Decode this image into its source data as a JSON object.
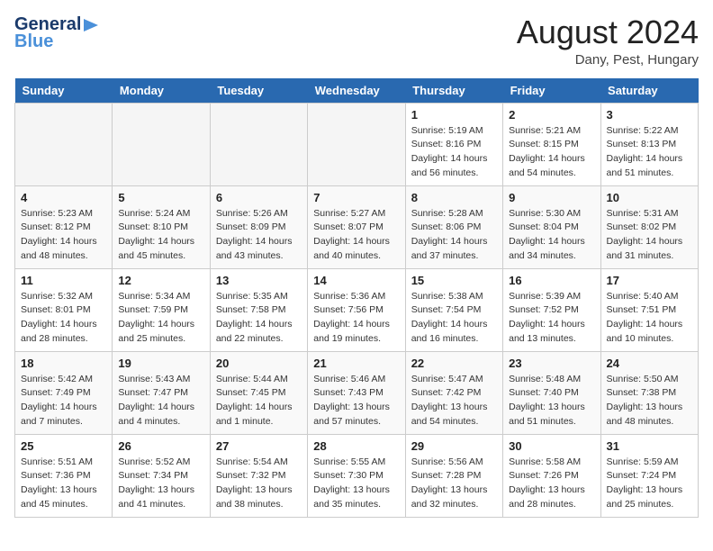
{
  "logo": {
    "name": "General",
    "name2": "Blue",
    "tagline": ""
  },
  "title": "August 2024",
  "location": "Dany, Pest, Hungary",
  "days_of_week": [
    "Sunday",
    "Monday",
    "Tuesday",
    "Wednesday",
    "Thursday",
    "Friday",
    "Saturday"
  ],
  "weeks": [
    [
      {
        "day": "",
        "info": ""
      },
      {
        "day": "",
        "info": ""
      },
      {
        "day": "",
        "info": ""
      },
      {
        "day": "",
        "info": ""
      },
      {
        "day": "1",
        "info": "Sunrise: 5:19 AM\nSunset: 8:16 PM\nDaylight: 14 hours\nand 56 minutes."
      },
      {
        "day": "2",
        "info": "Sunrise: 5:21 AM\nSunset: 8:15 PM\nDaylight: 14 hours\nand 54 minutes."
      },
      {
        "day": "3",
        "info": "Sunrise: 5:22 AM\nSunset: 8:13 PM\nDaylight: 14 hours\nand 51 minutes."
      }
    ],
    [
      {
        "day": "4",
        "info": "Sunrise: 5:23 AM\nSunset: 8:12 PM\nDaylight: 14 hours\nand 48 minutes."
      },
      {
        "day": "5",
        "info": "Sunrise: 5:24 AM\nSunset: 8:10 PM\nDaylight: 14 hours\nand 45 minutes."
      },
      {
        "day": "6",
        "info": "Sunrise: 5:26 AM\nSunset: 8:09 PM\nDaylight: 14 hours\nand 43 minutes."
      },
      {
        "day": "7",
        "info": "Sunrise: 5:27 AM\nSunset: 8:07 PM\nDaylight: 14 hours\nand 40 minutes."
      },
      {
        "day": "8",
        "info": "Sunrise: 5:28 AM\nSunset: 8:06 PM\nDaylight: 14 hours\nand 37 minutes."
      },
      {
        "day": "9",
        "info": "Sunrise: 5:30 AM\nSunset: 8:04 PM\nDaylight: 14 hours\nand 34 minutes."
      },
      {
        "day": "10",
        "info": "Sunrise: 5:31 AM\nSunset: 8:02 PM\nDaylight: 14 hours\nand 31 minutes."
      }
    ],
    [
      {
        "day": "11",
        "info": "Sunrise: 5:32 AM\nSunset: 8:01 PM\nDaylight: 14 hours\nand 28 minutes."
      },
      {
        "day": "12",
        "info": "Sunrise: 5:34 AM\nSunset: 7:59 PM\nDaylight: 14 hours\nand 25 minutes."
      },
      {
        "day": "13",
        "info": "Sunrise: 5:35 AM\nSunset: 7:58 PM\nDaylight: 14 hours\nand 22 minutes."
      },
      {
        "day": "14",
        "info": "Sunrise: 5:36 AM\nSunset: 7:56 PM\nDaylight: 14 hours\nand 19 minutes."
      },
      {
        "day": "15",
        "info": "Sunrise: 5:38 AM\nSunset: 7:54 PM\nDaylight: 14 hours\nand 16 minutes."
      },
      {
        "day": "16",
        "info": "Sunrise: 5:39 AM\nSunset: 7:52 PM\nDaylight: 14 hours\nand 13 minutes."
      },
      {
        "day": "17",
        "info": "Sunrise: 5:40 AM\nSunset: 7:51 PM\nDaylight: 14 hours\nand 10 minutes."
      }
    ],
    [
      {
        "day": "18",
        "info": "Sunrise: 5:42 AM\nSunset: 7:49 PM\nDaylight: 14 hours\nand 7 minutes."
      },
      {
        "day": "19",
        "info": "Sunrise: 5:43 AM\nSunset: 7:47 PM\nDaylight: 14 hours\nand 4 minutes."
      },
      {
        "day": "20",
        "info": "Sunrise: 5:44 AM\nSunset: 7:45 PM\nDaylight: 14 hours\nand 1 minute."
      },
      {
        "day": "21",
        "info": "Sunrise: 5:46 AM\nSunset: 7:43 PM\nDaylight: 13 hours\nand 57 minutes."
      },
      {
        "day": "22",
        "info": "Sunrise: 5:47 AM\nSunset: 7:42 PM\nDaylight: 13 hours\nand 54 minutes."
      },
      {
        "day": "23",
        "info": "Sunrise: 5:48 AM\nSunset: 7:40 PM\nDaylight: 13 hours\nand 51 minutes."
      },
      {
        "day": "24",
        "info": "Sunrise: 5:50 AM\nSunset: 7:38 PM\nDaylight: 13 hours\nand 48 minutes."
      }
    ],
    [
      {
        "day": "25",
        "info": "Sunrise: 5:51 AM\nSunset: 7:36 PM\nDaylight: 13 hours\nand 45 minutes."
      },
      {
        "day": "26",
        "info": "Sunrise: 5:52 AM\nSunset: 7:34 PM\nDaylight: 13 hours\nand 41 minutes."
      },
      {
        "day": "27",
        "info": "Sunrise: 5:54 AM\nSunset: 7:32 PM\nDaylight: 13 hours\nand 38 minutes."
      },
      {
        "day": "28",
        "info": "Sunrise: 5:55 AM\nSunset: 7:30 PM\nDaylight: 13 hours\nand 35 minutes."
      },
      {
        "day": "29",
        "info": "Sunrise: 5:56 AM\nSunset: 7:28 PM\nDaylight: 13 hours\nand 32 minutes."
      },
      {
        "day": "30",
        "info": "Sunrise: 5:58 AM\nSunset: 7:26 PM\nDaylight: 13 hours\nand 28 minutes."
      },
      {
        "day": "31",
        "info": "Sunrise: 5:59 AM\nSunset: 7:24 PM\nDaylight: 13 hours\nand 25 minutes."
      }
    ]
  ]
}
